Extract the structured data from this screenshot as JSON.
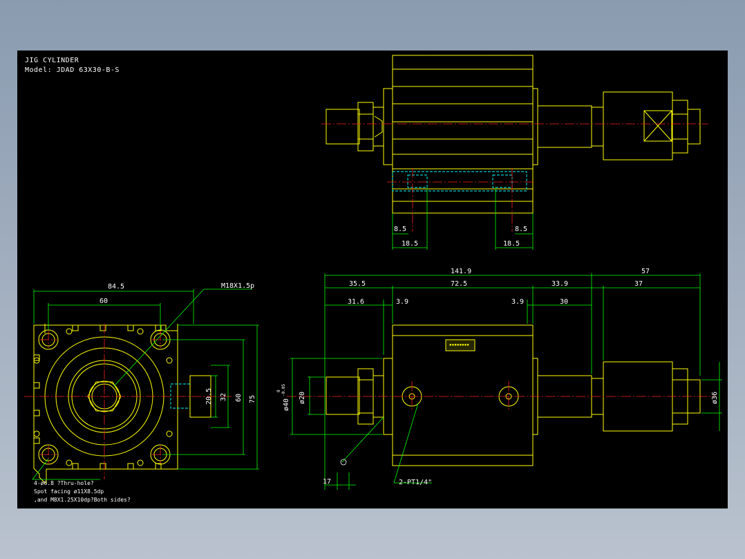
{
  "title": {
    "line1": "JIG CYLINDER",
    "line2": "Model: JDAD 63X30-B-S"
  },
  "dims": {
    "side_a": "84.5",
    "side_b": "60",
    "side_thread": "M18X1.5p",
    "side_c": "75",
    "side_d": "60",
    "side_e": "32",
    "side_f": "20.5",
    "top_a": "8.5",
    "top_b": "8.5",
    "top_c": "18.5",
    "top_d": "18.5",
    "front_total": "141.9",
    "front_ext": "57",
    "front_a": "35.5",
    "front_b": "72.5",
    "front_c": "33.9",
    "front_d": "37",
    "front_e": "31.6",
    "front_f": "3.9",
    "front_g": "3.9",
    "front_h": "30",
    "front_dia40": "ø40",
    "front_tol_up": "0",
    "front_tol_dn": "-0.05",
    "front_dia20": "ø20",
    "front_dia36": "ø36",
    "front_17": "17",
    "front_port": "2-PT1/4\""
  },
  "notes": {
    "line1": "4-ø6.8 ?Thru-hole?",
    "line2": "Spot facing ø11X8.5dp",
    "line3": ",and M8X1.25X10dp?Both sides?"
  },
  "colors": {
    "background": "#000000",
    "outline": "#ffff00",
    "dimension": "#00ff00",
    "center": "#ff2020",
    "hidden": "#00ffff"
  }
}
